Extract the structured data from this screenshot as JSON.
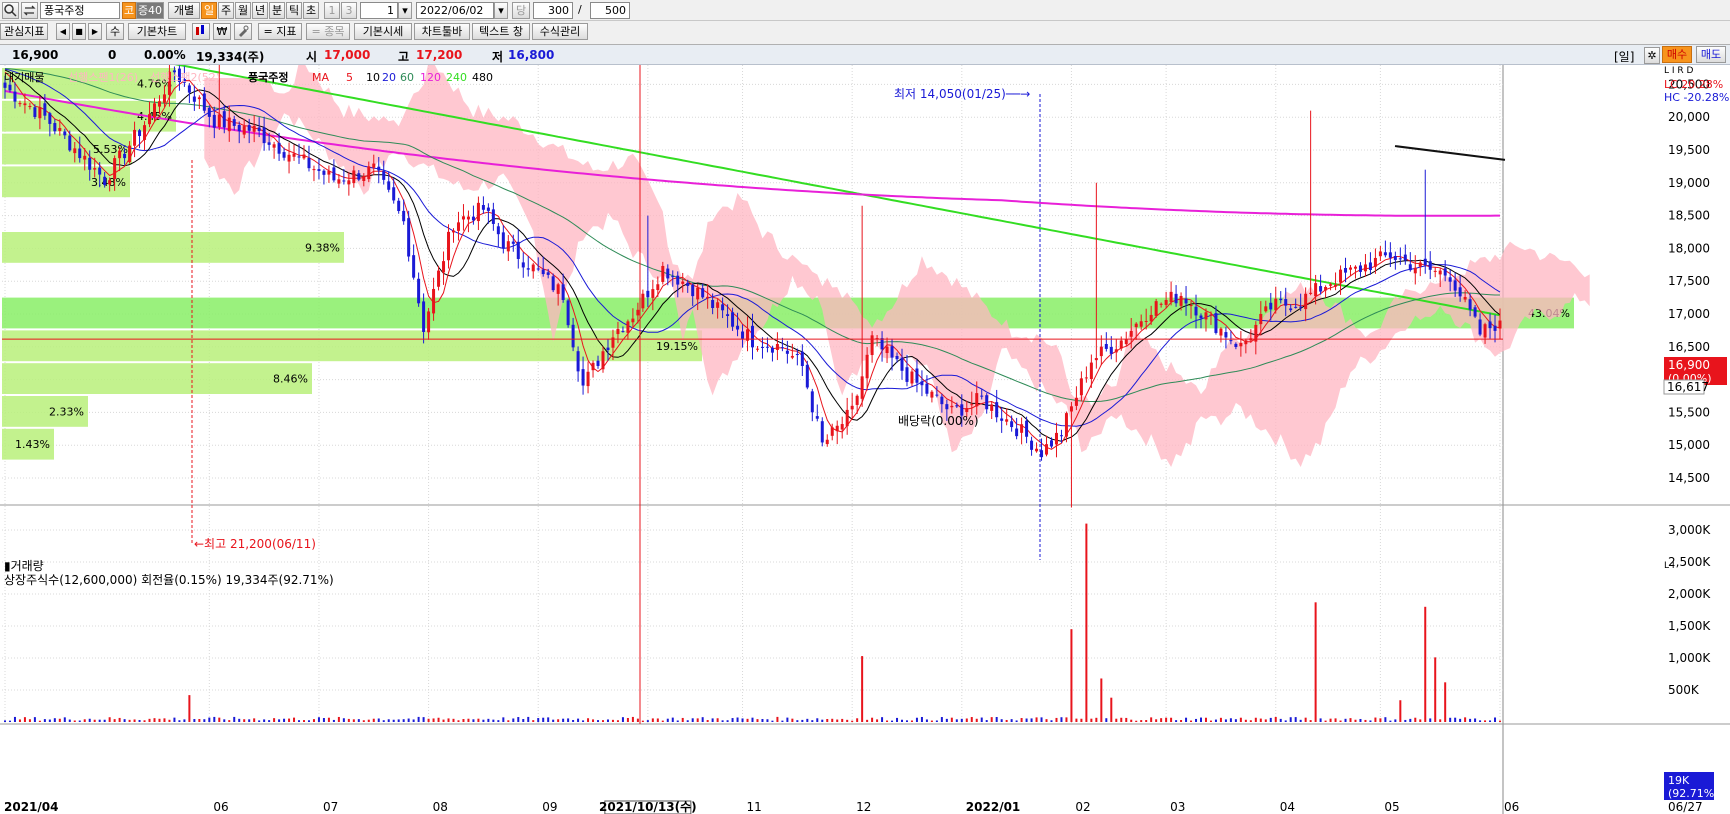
{
  "toolbar": {
    "search_icon": "search-icon",
    "swap_icon": "swap-icon",
    "stock_name": "풍국주정",
    "badge_market": "코",
    "badge_margin": "증40",
    "btn_individual": "개별",
    "periods": [
      "일",
      "주",
      "월",
      "년",
      "분",
      "틱",
      "초"
    ],
    "sub_periods": [
      "1",
      "3"
    ],
    "period_count": "1",
    "date": "2022/06/02",
    "dang_label": "당",
    "count_value": "300",
    "slash": "/",
    "total_value": "500",
    "row2": {
      "interest": "관심지표",
      "nav": [
        "◀",
        "■",
        "▶"
      ],
      "su": "수",
      "basic_chart": "기본차트",
      "won_icon": "₩",
      "tool_icon": "tool-icon",
      "indicator": "= 지표",
      "item": "= 종목",
      "basic_quote": "기본시세",
      "chart_toolbar": "차트툴바",
      "text_window": "텍스트 창",
      "formula": "수식관리"
    }
  },
  "quote": {
    "price": "16,900",
    "change": "0",
    "change_pct": "0.00%",
    "volume": "19,334(주)",
    "open_label": "시",
    "open": "17,000",
    "high_label": "고",
    "high": "17,200",
    "low_label": "저",
    "low": "16,800",
    "period_tag": "[일]",
    "buy": "매수",
    "sell": "매도"
  },
  "colors": {
    "up": "#e8141c",
    "down": "#1a1ad6",
    "ma5": "#e8141c",
    "ma10": "#000000",
    "ma20": "#1a1ad6",
    "ma60": "#2e8b57",
    "ma120": "#e820d8",
    "ma240": "#33dd22",
    "cloud": "#ffb6c1",
    "profile": "#b8f07a",
    "profile_dark": "#88ee66"
  },
  "chart_data": [
    {
      "type": "candlestick",
      "legend": [
        "대기매물",
        "선행스팬1(26)",
        "선행스팬2(52)",
        "풍국주정",
        "MA",
        "5",
        "10",
        "20",
        "60",
        "120",
        "240",
        "480"
      ],
      "x_ticks": [
        "2021/04",
        "06",
        "07",
        "08",
        "09",
        "2021/10/13(수)",
        "11",
        "12",
        "2022/01",
        "02",
        "03",
        "04",
        "05",
        "06"
      ],
      "y_ticks": [
        14500,
        15000,
        15500,
        16000,
        16500,
        17000,
        17500,
        18000,
        18500,
        19000,
        19500,
        20000,
        20500
      ],
      "y_range": [
        14100,
        21250
      ],
      "right_info": [
        "LC  20.28%",
        "HC -20.28%"
      ],
      "right_icons": "L I R D",
      "last_price": "16,900",
      "last_change": "(0.00%)",
      "ref_price": "16,617",
      "bottom_date": "06/27",
      "annotations": {
        "high": "최고 21,200(06/11)",
        "low": "최저 14,050(01/25)",
        "dividend": "배당락(0.00%)"
      },
      "volume_profile": [
        {
          "price": 20500,
          "pct": "4.76%"
        },
        {
          "price": 20000,
          "pct": "4.45%"
        },
        {
          "price": 19500,
          "pct": "5.53%"
        },
        {
          "price": 19000,
          "pct": "3.48%"
        },
        {
          "price": 18000,
          "pct": "9.38%"
        },
        {
          "price": 17000,
          "pct": "43.04%"
        },
        {
          "price": 16500,
          "pct": "19.15%"
        },
        {
          "price": 16000,
          "pct": "8.46%"
        },
        {
          "price": 15500,
          "pct": "2.33%"
        },
        {
          "price": 15000,
          "pct": "1.43%"
        }
      ],
      "close_keypoints": [
        [
          0,
          20450
        ],
        [
          8,
          20000
        ],
        [
          20,
          19050
        ],
        [
          28,
          19900
        ],
        [
          34,
          20700
        ],
        [
          42,
          19950
        ],
        [
          50,
          19800
        ],
        [
          58,
          19400
        ],
        [
          66,
          19050
        ],
        [
          74,
          19200
        ],
        [
          80,
          18400
        ],
        [
          84,
          16800
        ],
        [
          90,
          18400
        ],
        [
          96,
          18600
        ],
        [
          100,
          18100
        ],
        [
          106,
          17700
        ],
        [
          112,
          17300
        ],
        [
          116,
          15900
        ],
        [
          122,
          16700
        ],
        [
          126,
          17000
        ],
        [
          132,
          17700
        ],
        [
          138,
          17400
        ],
        [
          144,
          17000
        ],
        [
          150,
          16600
        ],
        [
          156,
          16500
        ],
        [
          160,
          16200
        ],
        [
          164,
          15000
        ],
        [
          170,
          15500
        ],
        [
          174,
          16600
        ],
        [
          182,
          16000
        ],
        [
          190,
          15500
        ],
        [
          196,
          15700
        ],
        [
          204,
          15200
        ],
        [
          208,
          14900
        ],
        [
          212,
          15200
        ],
        [
          218,
          16300
        ],
        [
          224,
          16600
        ],
        [
          230,
          17100
        ],
        [
          236,
          17300
        ],
        [
          242,
          16900
        ],
        [
          248,
          16500
        ],
        [
          254,
          17100
        ],
        [
          260,
          17200
        ],
        [
          266,
          17500
        ],
        [
          272,
          17700
        ],
        [
          278,
          17900
        ],
        [
          284,
          17700
        ],
        [
          290,
          17600
        ],
        [
          296,
          16700
        ],
        [
          300,
          16900
        ]
      ]
    },
    {
      "type": "bar",
      "title": "거래량",
      "info": "상장주식수(12,600,000) 회전율(0.15%) 19,334주(92.71%)",
      "y_ticks": [
        "500K",
        "1,000K",
        "1,500K",
        "2,000K",
        "2,500K",
        "3,000K"
      ],
      "y_range": [
        0,
        3250000
      ],
      "last_volume": "19K",
      "last_volume_pct": "(92.71%)",
      "spikes": [
        {
          "bar": 37,
          "value": 420000
        },
        {
          "bar": 172,
          "value": 1030000
        },
        {
          "bar": 214,
          "value": 1450000
        },
        {
          "bar": 217,
          "value": 3100000
        },
        {
          "bar": 220,
          "value": 680000
        },
        {
          "bar": 222,
          "value": 380000
        },
        {
          "bar": 263,
          "value": 1870000
        },
        {
          "bar": 280,
          "value": 340000
        },
        {
          "bar": 285,
          "value": 1800000
        },
        {
          "bar": 287,
          "value": 1010000
        },
        {
          "bar": 289,
          "value": 620000
        }
      ]
    }
  ]
}
